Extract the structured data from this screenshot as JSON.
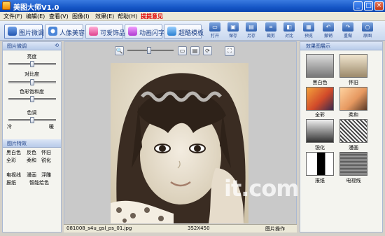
{
  "window": {
    "title": "美图大师V1.0"
  },
  "menu": {
    "items": [
      "文件(F)",
      "编辑(E)",
      "查看(V)",
      "图像(I)",
      "效果(E)",
      "帮助(H)",
      "提提意见"
    ]
  },
  "tabs": [
    {
      "label": "图片微调",
      "icon": "photo-adjust-icon",
      "active": true
    },
    {
      "label": "人像美容",
      "icon": "portrait-icon",
      "active": false
    },
    {
      "label": "可爱饰品",
      "icon": "accessory-icon",
      "active": false
    },
    {
      "label": "动画闪字",
      "icon": "animation-icon",
      "active": false
    },
    {
      "label": "超酷模板",
      "icon": "template-icon",
      "active": false
    }
  ],
  "toolbar": {
    "buttons": [
      {
        "label": "打开",
        "icon": "open-icon"
      },
      {
        "label": "保存",
        "icon": "save-icon"
      },
      {
        "label": "另存",
        "icon": "save-as-icon"
      },
      {
        "label": "裁剪",
        "icon": "crop-icon"
      },
      {
        "label": "对比",
        "icon": "compare-icon"
      },
      {
        "label": "预览",
        "icon": "preview-icon"
      },
      {
        "label": "撤销",
        "icon": "undo-icon"
      },
      {
        "label": "重做",
        "icon": "redo-icon"
      },
      {
        "label": "原图",
        "icon": "original-icon"
      }
    ]
  },
  "left_panel": {
    "adjust_header": "图片微调",
    "sliders": [
      {
        "label": "亮度",
        "value": 0.5
      },
      {
        "label": "对比度",
        "value": 0.5
      },
      {
        "label": "色彩饱和度",
        "value": 0.5
      },
      {
        "label": "色调",
        "value": 0.5
      }
    ],
    "tone_min": "冷",
    "tone_max": "暖",
    "effects_header": "图片特效",
    "effects_rows": [
      [
        "黑白色",
        "反色",
        "怀旧"
      ],
      [
        "全彩",
        "柔和",
        "锐化"
      ],
      [
        "电视线",
        "漫画",
        "浮雕"
      ],
      [
        "报纸",
        "智能绘色"
      ]
    ]
  },
  "status": {
    "filename": "081008_s4u_gsl_ps_01.jpg",
    "dimensions": "352X450",
    "panel_label": "图片操作"
  },
  "right_panel": {
    "header": "效果图展示",
    "thumbnails": [
      "黑白色",
      "怀旧",
      "全彩",
      "柔和",
      "锐化",
      "漫画",
      "报纸",
      "电视线"
    ]
  },
  "watermark": "it.com.cn",
  "colors": {
    "titlebar": "#1657c7",
    "panel_border": "#a9b8d3",
    "menu_highlight": "#e00000"
  }
}
